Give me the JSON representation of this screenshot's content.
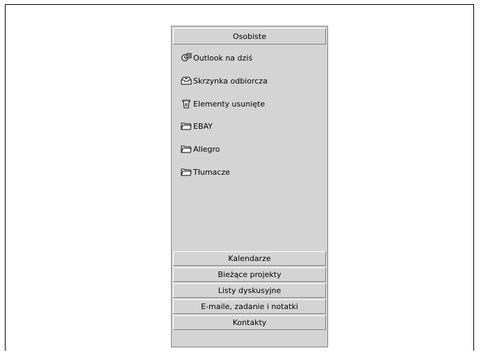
{
  "window": {
    "title": ""
  },
  "outlook_bar": {
    "active_group": {
      "label": "Osobiste",
      "items": [
        {
          "label": "Outlook na dziś",
          "icon": "outlook-today-icon"
        },
        {
          "label": "Skrzynka odbiorcza",
          "icon": "inbox-icon"
        },
        {
          "label": "Elementy usunięte",
          "icon": "trash-icon"
        },
        {
          "label": "EBAY",
          "icon": "folder-icon"
        },
        {
          "label": "Allegro",
          "icon": "folder-icon"
        },
        {
          "label": "Tłumacze",
          "icon": "folder-icon"
        }
      ]
    },
    "groups": [
      {
        "label": "Kalendarze"
      },
      {
        "label": "Bieżące projekty"
      },
      {
        "label": "Listy dyskusyjne"
      },
      {
        "label": "E-maile, zadanie i notatki"
      },
      {
        "label": "Kontakty"
      }
    ]
  }
}
